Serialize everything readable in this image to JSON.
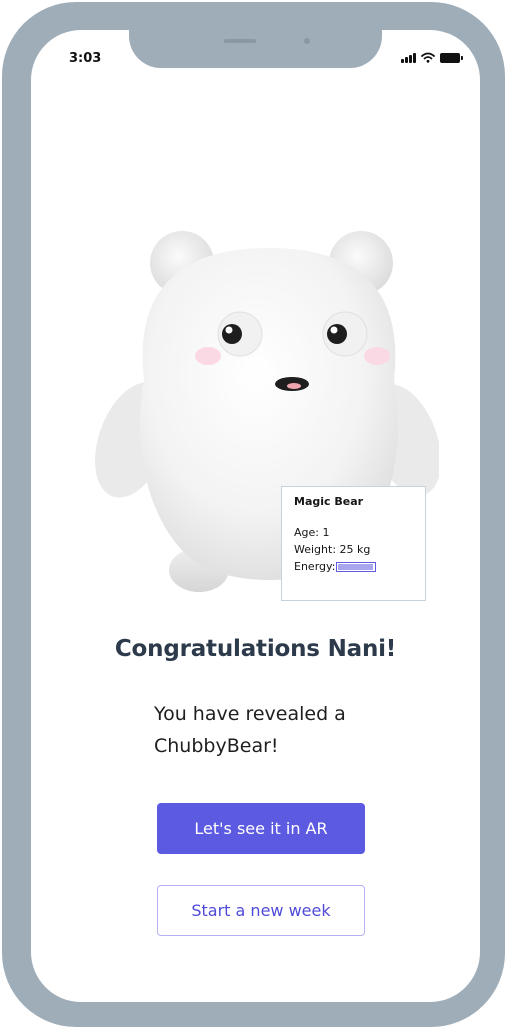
{
  "status_bar": {
    "time": "3:03",
    "icons": [
      "signal-icon",
      "wifi-icon",
      "battery-icon"
    ]
  },
  "pet_card": {
    "name": "Magic Bear",
    "age_label": "Age: 1",
    "weight_label": "Weight: 25 kg",
    "energy_label": "Energy:",
    "energy_level": 0.95
  },
  "headline": "Congratulations Nani!",
  "message": {
    "line1": "You have revealed a",
    "line2": "ChubbyBear!"
  },
  "buttons": {
    "primary": "Let's see it in AR",
    "secondary": "Start a new week"
  },
  "colors": {
    "frame": "#9fadb9",
    "accent": "#5d5ae2",
    "headline": "#2c3a4b",
    "secondary_text": "#4f4bd8"
  }
}
